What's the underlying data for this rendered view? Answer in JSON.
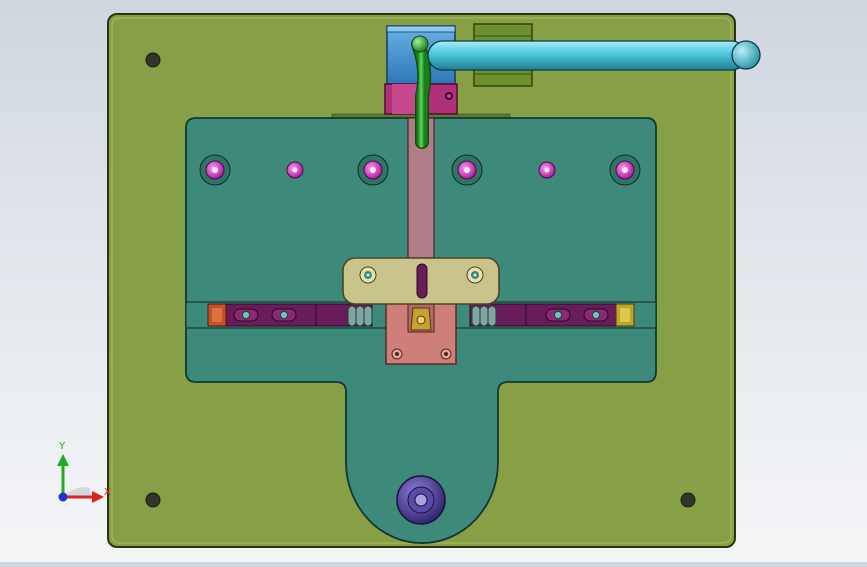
{
  "viewport": {
    "colors": {
      "background_top": "#cfd6de",
      "background_bottom": "#f4f5f7",
      "base_plate": "#87a046",
      "fixture_plate": "#3e8a7a",
      "slider": "#b07c88",
      "clamp_block": "#c8c48c",
      "rail": "#6a1c5a",
      "handle": "#4cc6dc",
      "lever": "#2ea82e",
      "pink_hole": "#d33fcf",
      "knob": "#4a3a8e"
    }
  },
  "triad": {
    "y_label": "Y",
    "x_label": "X",
    "y_color": "#22aa22",
    "x_color": "#dd2222",
    "origin_color": "#2233cc"
  }
}
